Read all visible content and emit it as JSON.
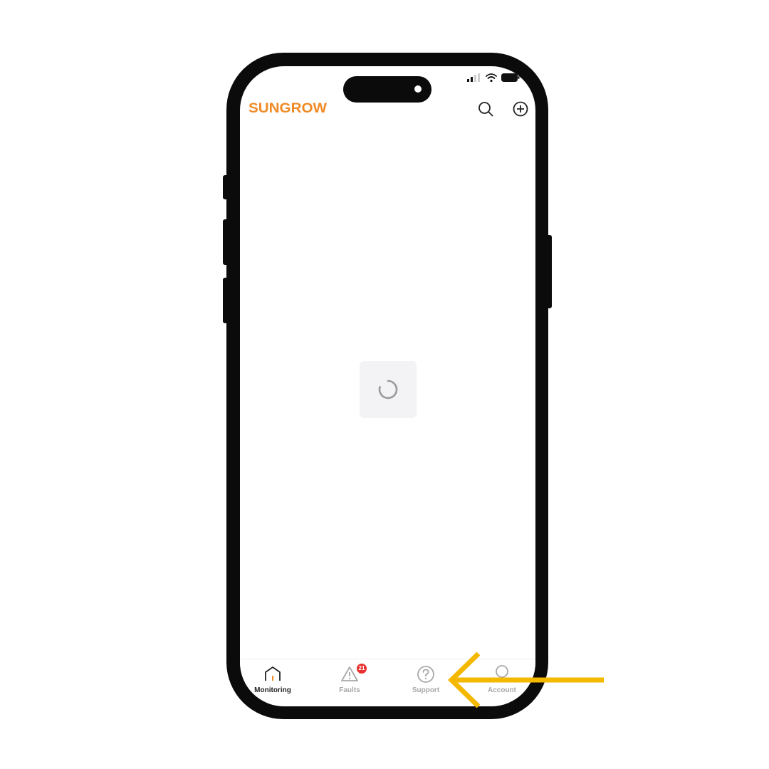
{
  "app": {
    "brand_logo_text": "SUNGROW",
    "brand_color": "#f08a24"
  },
  "header": {
    "search_icon": "search-icon",
    "add_icon": "plus-circle-icon"
  },
  "main": {
    "loading_indicator": "spinner-icon"
  },
  "tabbar": {
    "tabs": [
      {
        "label": "Monitoring",
        "icon": "home-icon",
        "active": true
      },
      {
        "label": "Faults",
        "icon": "warning-triangle-icon",
        "badge": "21"
      },
      {
        "label": "Support",
        "icon": "question-circle-icon"
      },
      {
        "label": "Account",
        "icon": "user-icon"
      }
    ]
  },
  "annotation": {
    "arrow_color": "#f5b800",
    "points_to": "Support"
  }
}
